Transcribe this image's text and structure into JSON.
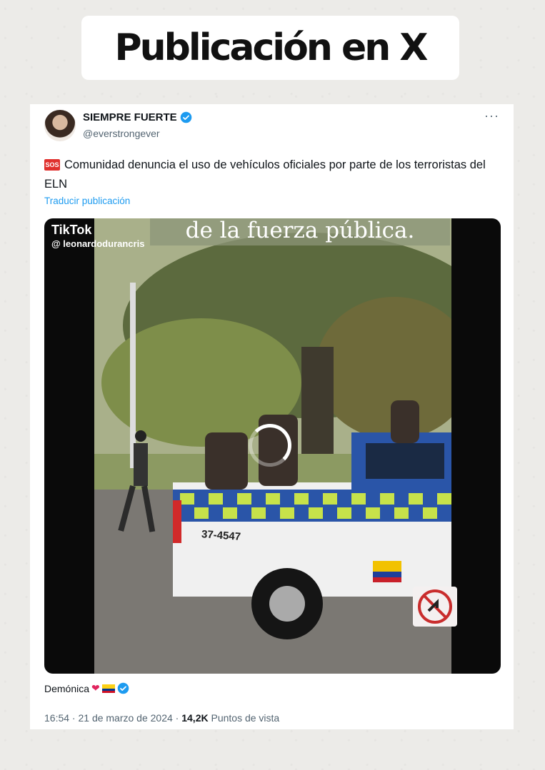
{
  "banner": {
    "title": "Publicación en X"
  },
  "tweet": {
    "display_name": "SIEMPRE FUERTE",
    "handle": "@everstrongever",
    "more_label": "···",
    "sos_label": "SOS",
    "text": "Comunidad denuncia el uso de vehículos oficiales por parte de los terroristas del ELN",
    "translate": "Traducir publicación",
    "media": {
      "caption": "de la fuerza pública.",
      "watermark": "TikTok",
      "watermark_user": "@ leonardodurancris",
      "plate": "37-4547"
    },
    "quoted_author": "Demónica",
    "time": "16:54 · 21 de marzo de 2024 · ",
    "views_count": "14,2K",
    "views_label": " Puntos de vista"
  },
  "colors": {
    "accent": "#1d9bf0",
    "text": "#0f1419",
    "muted": "#536471"
  }
}
